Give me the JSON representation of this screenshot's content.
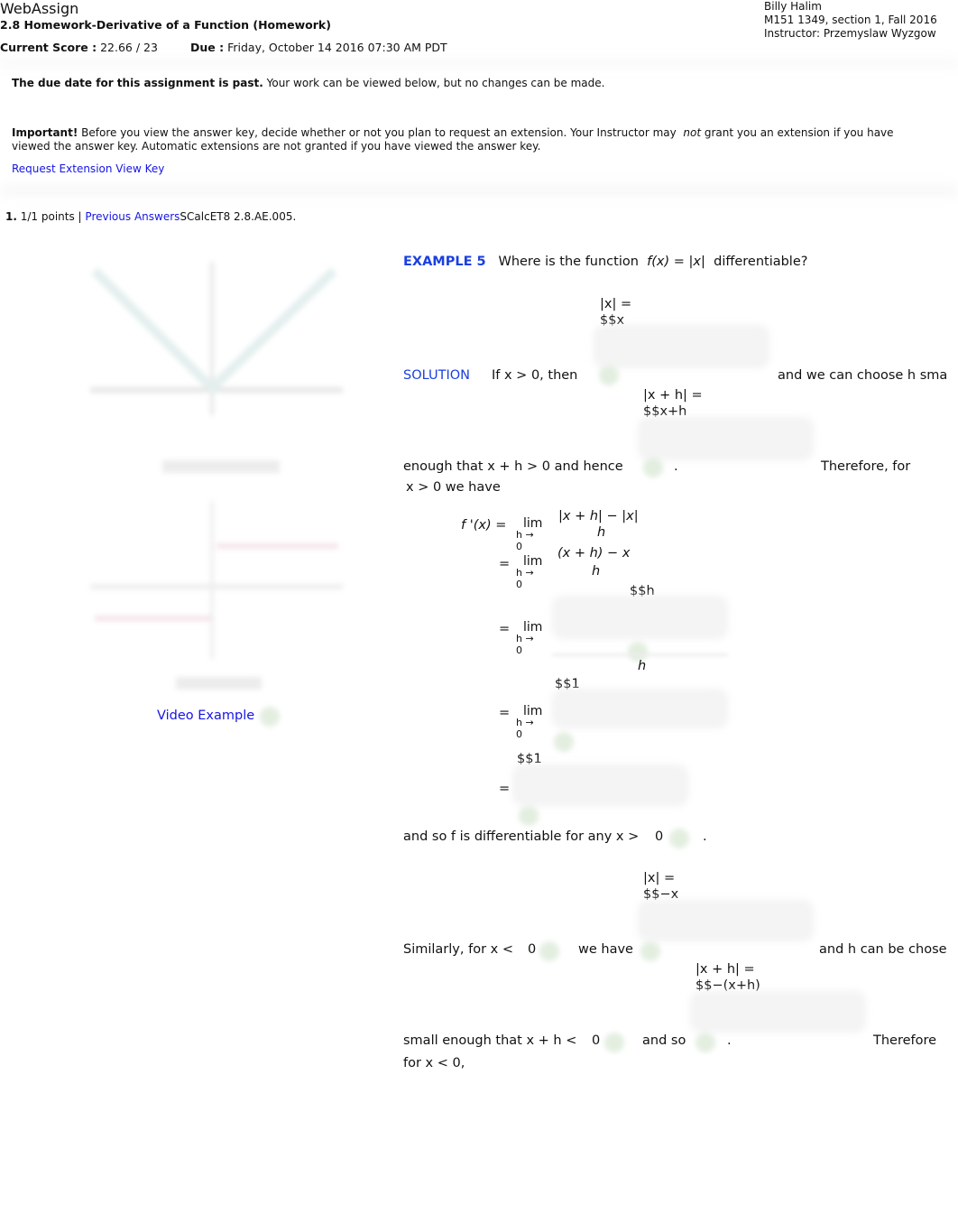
{
  "header": {
    "brand": "WebAssign",
    "assignment_title": "2.8 Homework-Derivative of a Function (Homework)",
    "score_label": "Current Score :",
    "score_value": "22.66 / 23",
    "due_label": "Due :",
    "due_value": "Friday, October 14 2016 07:30 AM PDT",
    "user_name": "Billy Halim",
    "course": "M151 1349, section 1, Fall 2016",
    "instructor": "Instructor: Przemyslaw Wyzgow"
  },
  "notice": {
    "past_bold": "The due date for this assignment is past.",
    "past_text": "Your work can be viewed below, but no changes can be made.",
    "important_bold": "Important!",
    "important_text_1": "Before you view the answer key, decide whether or not you plan to request an extension. Your Instructor may",
    "important_not": "not",
    "important_text_2": "grant you an extension if you have",
    "important_text_3": "viewed the answer key. Automatic extensions are not granted if you have viewed the answer key.",
    "request_extension": "Request Extension",
    "view_key": "View Key"
  },
  "question": {
    "number": "1.",
    "points": "1/1 points |",
    "previous_answers": "Previous Answers",
    "source": "SCalcET8 2.8.AE.005.",
    "video_example": "Video Example"
  },
  "example": {
    "label": "EXAMPLE 5",
    "prompt": "Where is the function",
    "fx": "f(x) = |x|",
    "prompt_end": "differentiable?",
    "solution": "SOLUTION",
    "if_x_pos": "If  x > 0,  then",
    "abs_x_eq": "|x| =",
    "ans_x": "$$x",
    "choose_h": "and we can choose h sma",
    "abs_xh_eq": "|x + h| =",
    "ans_xh": "$$x+h",
    "enough_that": "enough that  x + h > 0  and hence",
    "period": ".",
    "therefore_for": "Therefore, for",
    "x_pos_have": "x > 0  we have",
    "fprime": "f '(x)  =",
    "lim": "lim",
    "lim_sub": "h → 0",
    "eq": "=",
    "num1": "|x + h| − |x|",
    "den": "h",
    "num2": "(x + h) − x",
    "ans_h": "$$h",
    "ans_1a": "$$1",
    "ans_1b": "$$1",
    "diff_any": "and so f is differentiable for any  x >",
    "zero": "0",
    "abs_x_eq2": "|x| =",
    "ans_negx": "$$−x",
    "similarly": "Similarly, for  x <",
    "we_have": "we have",
    "h_chosen": "and h can be chose",
    "abs_xh_eq2": "|x + h| =",
    "ans_negxh": "$$−(x+h)",
    "small_enough": "small enough that  x + h <",
    "and_so": "and so",
    "therefore": "Therefore",
    "for_x_neg": "for  x < 0,"
  }
}
